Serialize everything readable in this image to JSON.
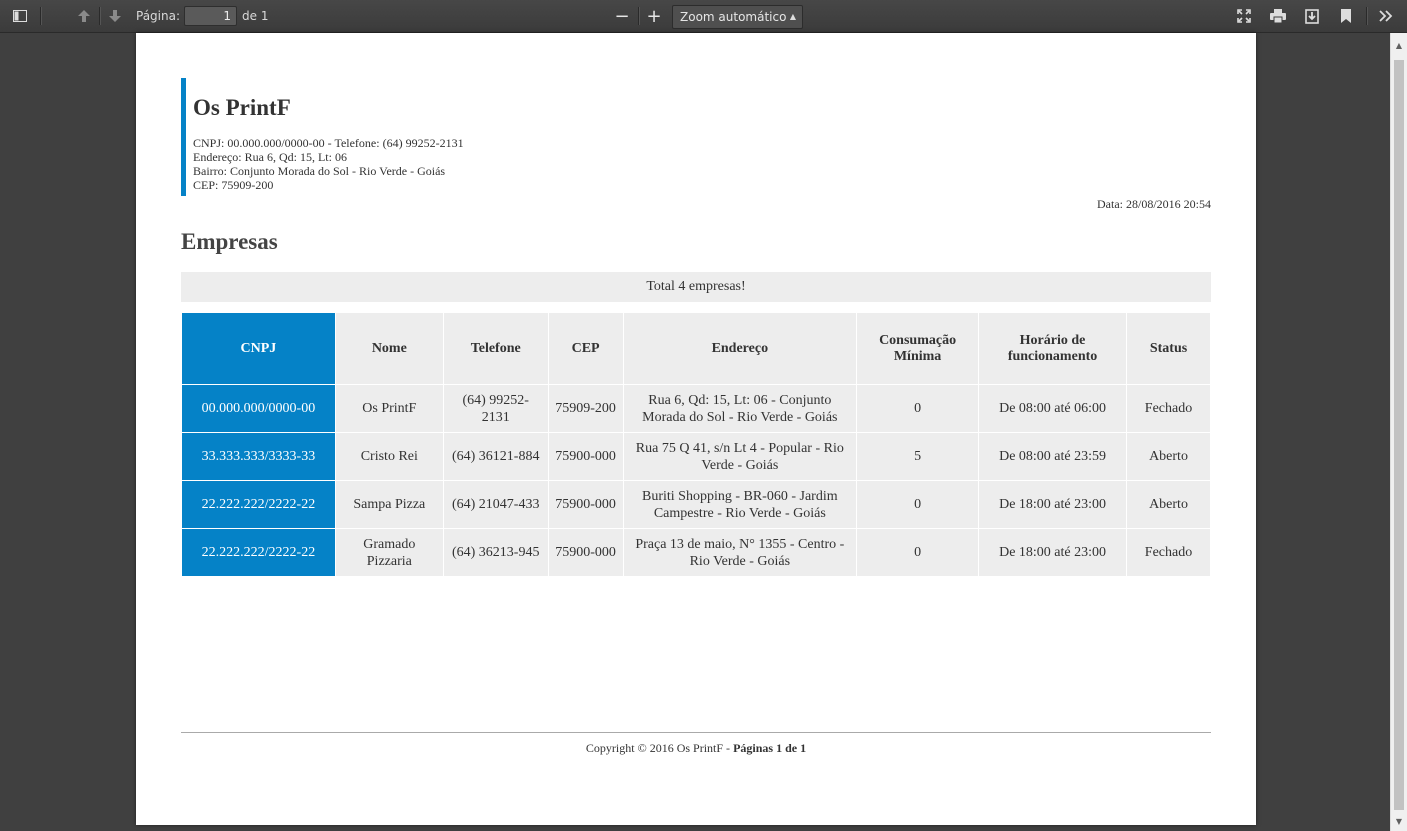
{
  "toolbar": {
    "page_label": "Página:",
    "page_value": "1",
    "page_total": "de 1",
    "zoom_value": "Zoom automático",
    "zoom_out": "−",
    "zoom_in": "+"
  },
  "company": {
    "name": "Os PrintF",
    "cnpj_phone": "CNPJ: 00.000.000/0000-00 - Telefone: (64) 99252-2131",
    "address": "Endereço: Rua 6, Qd: 15, Lt: 06",
    "district": "Bairro: Conjunto Morada do Sol - Rio Verde - Goiás",
    "cep": "CEP: 75909-200"
  },
  "date": "Data: 28/08/2016 20:54",
  "section_title": "Empresas",
  "total_text": "Total 4 empresas!",
  "table": {
    "headers": [
      "CNPJ",
      "Nome",
      "Telefone",
      "CEP",
      "Endereço",
      "Consumação Mínima",
      "Horário de funcionamento",
      "Status"
    ],
    "rows": [
      [
        "00.000.000/0000-00",
        "Os PrintF",
        "(64) 99252-2131",
        "75909-200",
        "Rua 6, Qd: 15, Lt: 06 - Conjunto Morada do Sol - Rio Verde - Goiás",
        "0",
        "De 08:00 até 06:00",
        "Fechado"
      ],
      [
        "33.333.333/3333-33",
        "Cristo Rei",
        "(64) 36121-884",
        "75900-000",
        "Rua 75 Q 41, s/n Lt 4 - Popular - Rio Verde - Goiás",
        "5",
        "De 08:00 até 23:59",
        "Aberto"
      ],
      [
        "22.222.222/2222-22",
        "Sampa Pizza",
        "(64) 21047-433",
        "75900-000",
        "Buriti Shopping - BR-060 - Jardim Campestre - Rio Verde - Goiás",
        "0",
        "De 18:00 até 23:00",
        "Aberto"
      ],
      [
        "22.222.222/2222-22",
        "Gramado Pizzaria",
        "(64) 36213-945",
        "75900-000",
        "Praça 13 de maio, N° 1355 - Centro - Rio Verde - Goiás",
        "0",
        "De 18:00 até 23:00",
        "Fechado"
      ]
    ]
  },
  "footer": {
    "copyright": "Copyright © 2016 Os PrintF - ",
    "pages": "Páginas 1 de 1"
  },
  "colors": {
    "accent": "#0582c7",
    "cell_bg": "#ededed"
  }
}
